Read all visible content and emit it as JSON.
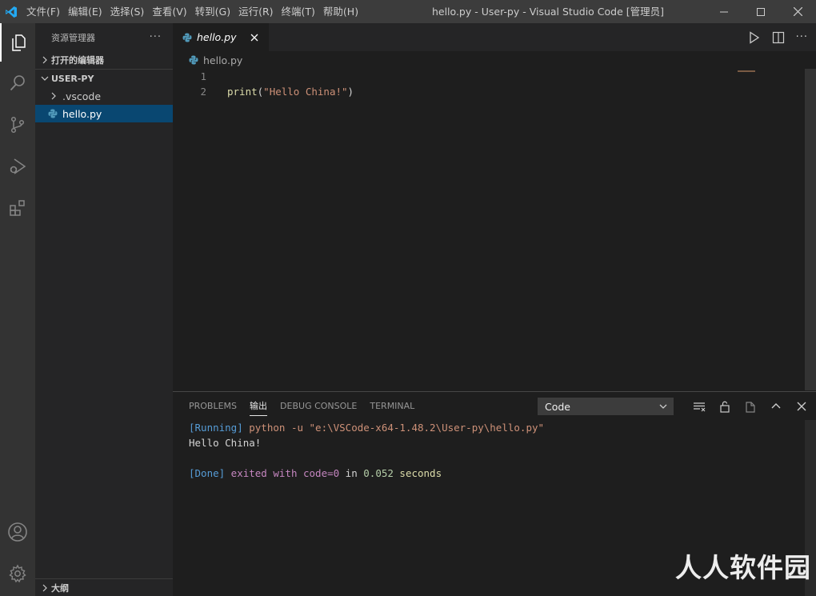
{
  "window": {
    "title": "hello.py - User-py - Visual Studio Code [管理员]",
    "menu": [
      "文件(F)",
      "编辑(E)",
      "选择(S)",
      "查看(V)",
      "转到(G)",
      "运行(R)",
      "终端(T)",
      "帮助(H)"
    ]
  },
  "activitybar": {
    "items": [
      "explorer-icon",
      "search-icon",
      "source-control-icon",
      "run-debug-icon",
      "extensions-icon"
    ],
    "bottom": [
      "account-icon",
      "settings-gear-icon"
    ]
  },
  "sidebar": {
    "title": "资源管理器",
    "more": "···",
    "open_editors": "打开的编辑器",
    "folder": "USER-PY",
    "tree": [
      {
        "label": ".vscode",
        "type": "folder"
      },
      {
        "label": "hello.py",
        "type": "file",
        "selected": true
      }
    ],
    "outline": "大纲"
  },
  "editor": {
    "tab_label": "hello.py",
    "breadcrumb": "hello.py",
    "lines": [
      {
        "no": "1",
        "fn": "",
        "p1": "",
        "str": "",
        "p2": ""
      },
      {
        "no": "2",
        "fn": "print",
        "p1": "(",
        "str": "\"Hello China!\"",
        "p2": ")"
      }
    ]
  },
  "panel": {
    "tabs": [
      "PROBLEMS",
      "输出",
      "DEBUG CONSOLE",
      "TERMINAL"
    ],
    "active_tab": "输出",
    "output_channel": "Code",
    "output": {
      "running_tag": "[Running]",
      "running_cmd": " python -u \"e:\\VSCode-x64-1.48.2\\User-py\\hello.py\"",
      "result": "Hello China!",
      "done_tag": "[Done]",
      "done_exited": " exited with ",
      "done_code": "code=0",
      "done_in": " in ",
      "done_time": "0.052",
      "done_seconds": " seconds"
    }
  },
  "watermark": "人人软件园",
  "colors": {
    "accent": "#007acc",
    "selection": "#094771",
    "titlebar": "#3c3c3c",
    "activitybar": "#333333",
    "sidebar": "#252526",
    "editor": "#1e1e1e"
  }
}
